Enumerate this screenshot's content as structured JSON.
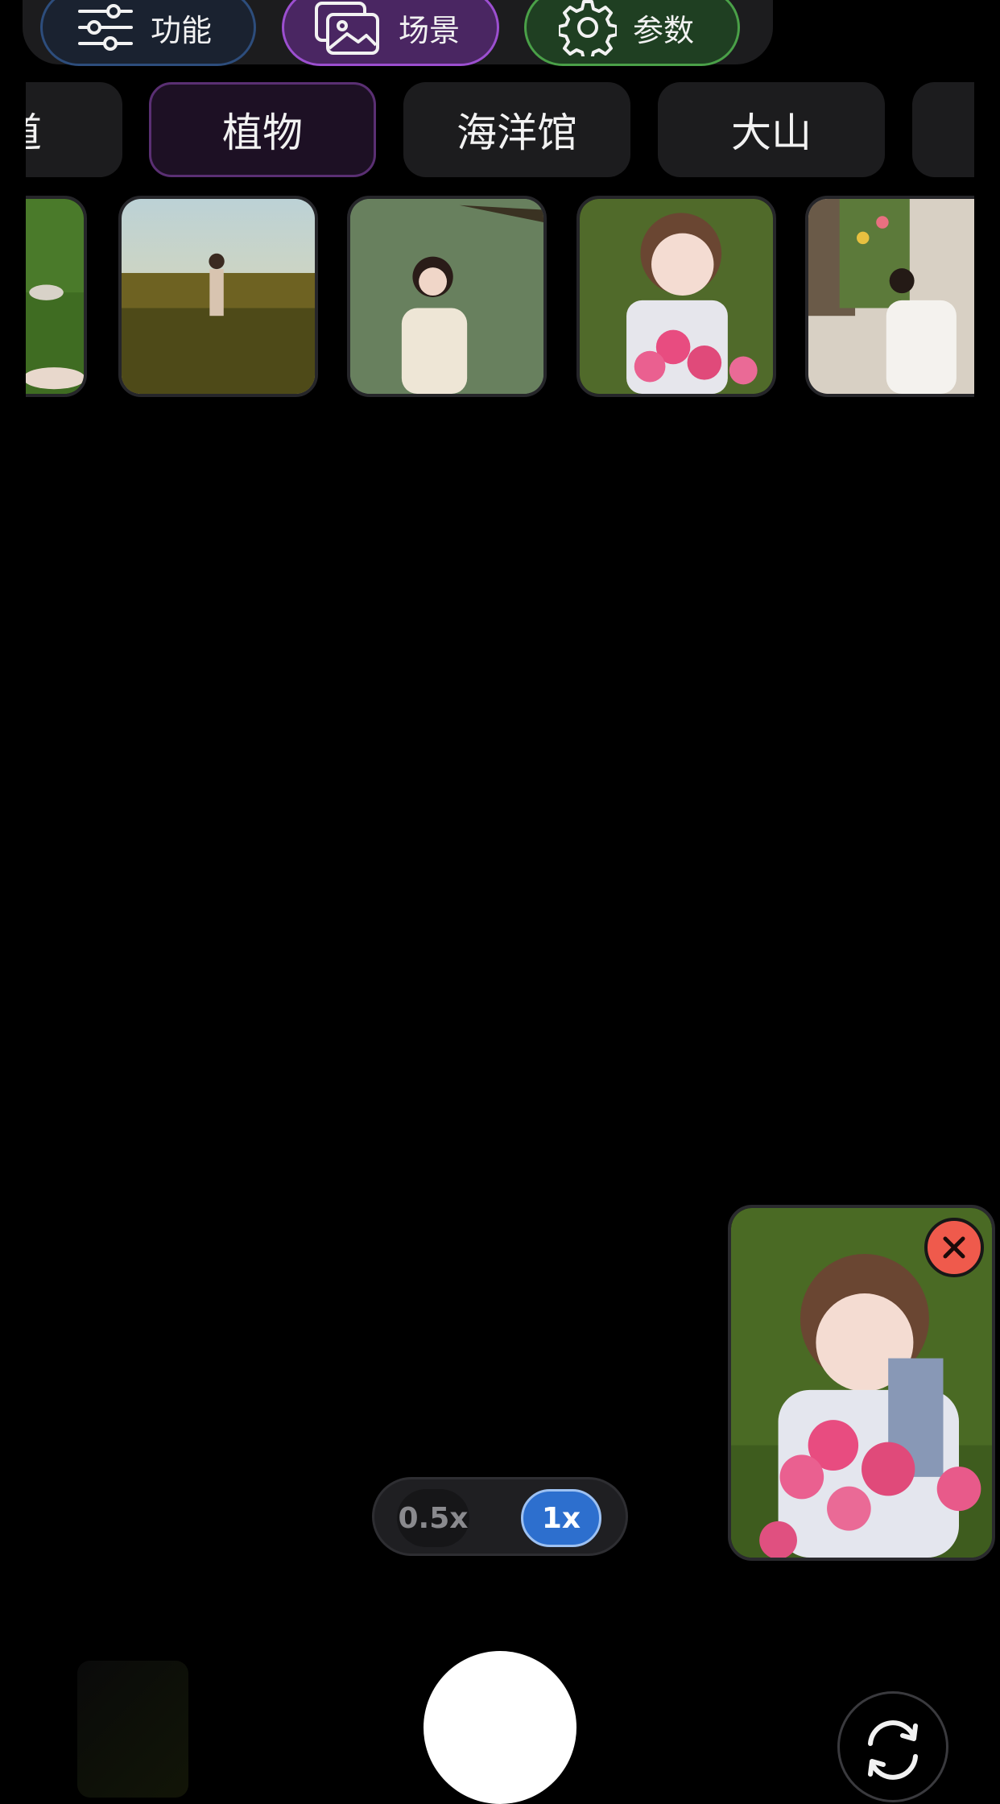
{
  "modes": [
    {
      "label": "功能",
      "icon": "sliders-icon",
      "color": "#2d4d7c"
    },
    {
      "label": "场景",
      "icon": "image-gallery-icon",
      "color": "#9c4fd0"
    },
    {
      "label": "参数",
      "icon": "gear-icon",
      "color": "#4aa048"
    }
  ],
  "categories": [
    "道",
    "植物",
    "海洋馆",
    "大山"
  ],
  "active_category": "植物",
  "zoom": {
    "options": [
      "0.5x",
      "1x"
    ],
    "selected": "1x"
  },
  "colors": {
    "accent_blue": "#2d6fce",
    "close_red": "#ef5a4c",
    "background": "#000000"
  }
}
